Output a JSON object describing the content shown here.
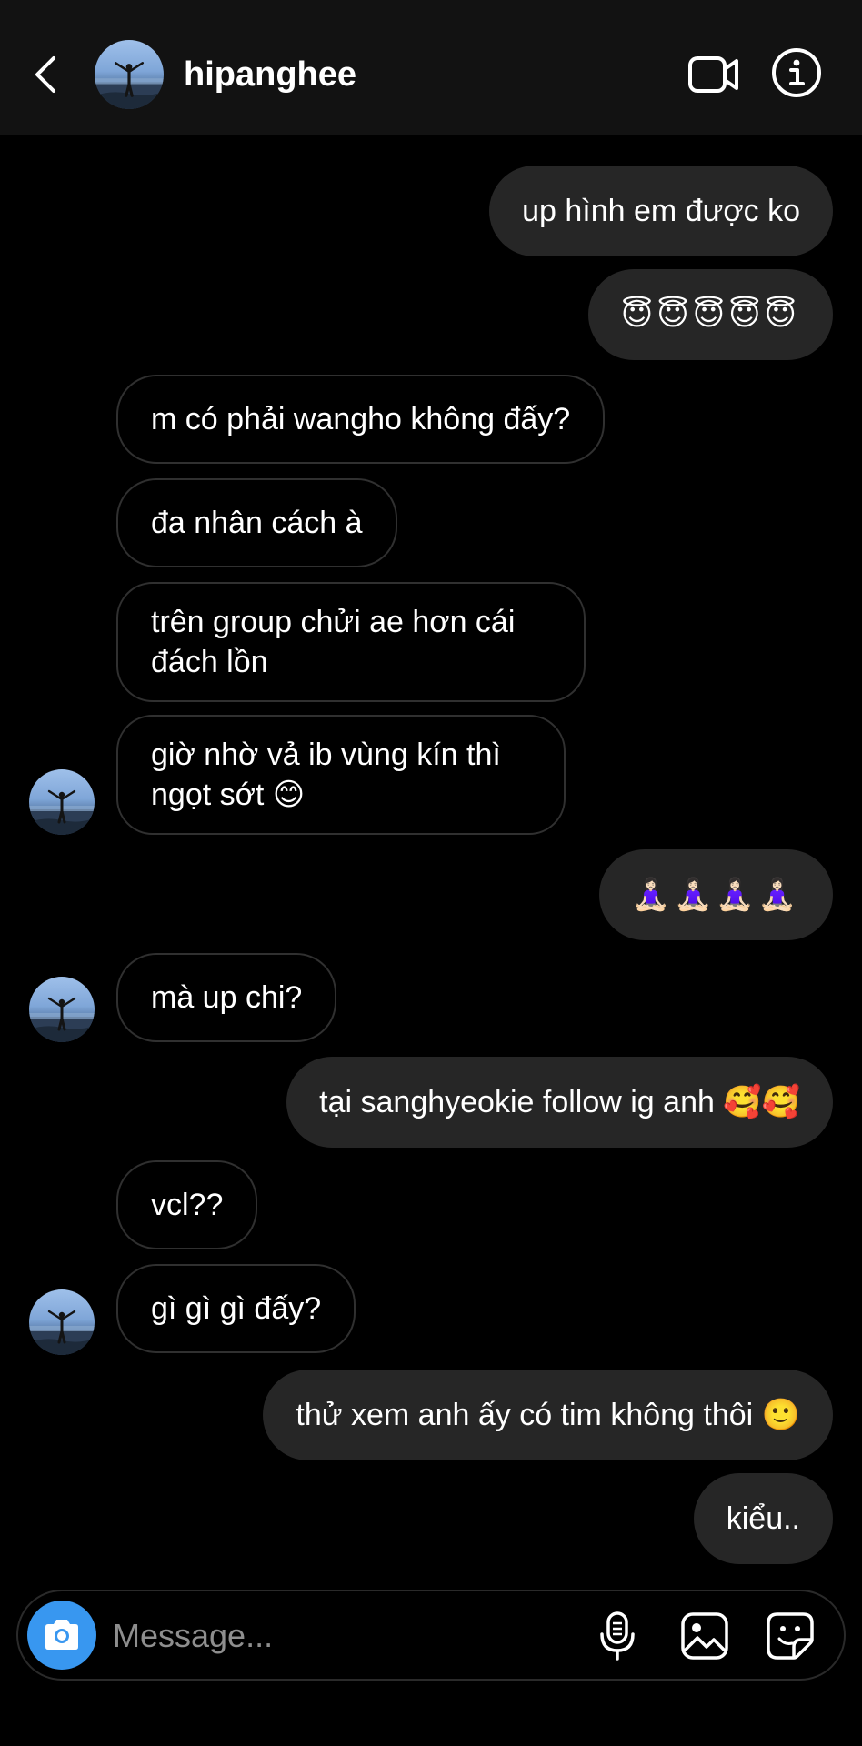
{
  "header": {
    "username": "hipanghee"
  },
  "messages": [
    {
      "id": "m1",
      "from": "me",
      "text": "up hình em được ko"
    },
    {
      "id": "m2",
      "from": "me",
      "text": "😇😇😇😇😇"
    },
    {
      "id": "m3",
      "from": "them",
      "text": "m có phải wangho không đấy?"
    },
    {
      "id": "m4",
      "from": "them",
      "text": "đa nhân cách à"
    },
    {
      "id": "m5",
      "from": "them",
      "text": "trên group chửi ae hơn cái đách lồn"
    },
    {
      "id": "m6",
      "from": "them",
      "text": "giờ nhờ vả ib vùng kín thì ngọt sớt 😊"
    },
    {
      "id": "m7",
      "from": "me",
      "text": "🧘🏻‍♀️🧘🏻‍♀️🧘🏻‍♀️🧘🏻‍♀️"
    },
    {
      "id": "m8",
      "from": "them",
      "text": "mà up chi?"
    },
    {
      "id": "m9",
      "from": "me",
      "text": "tại sanghyeokie follow ig anh 🥰🥰"
    },
    {
      "id": "m10",
      "from": "them",
      "text": "vcl??"
    },
    {
      "id": "m11",
      "from": "them",
      "text": "gì gì gì đấy?"
    },
    {
      "id": "m12",
      "from": "me",
      "text": "thử xem anh ấy có tim không thôi 🙂"
    },
    {
      "id": "m13",
      "from": "me",
      "text": "kiểu.."
    }
  ],
  "composer": {
    "placeholder": "Message..."
  },
  "icons": {
    "back": "chevron-left-icon",
    "video": "video-camera-icon",
    "info": "info-icon",
    "camera": "camera-icon",
    "mic": "microphone-icon",
    "gallery": "image-gallery-icon",
    "sticker": "sticker-icon"
  },
  "colors": {
    "background": "#000000",
    "header": "#121212",
    "my_bubble": "#262626",
    "their_bubble_border": "#303030",
    "camera_button": "#3897f0",
    "placeholder": "#8e8e8e"
  }
}
